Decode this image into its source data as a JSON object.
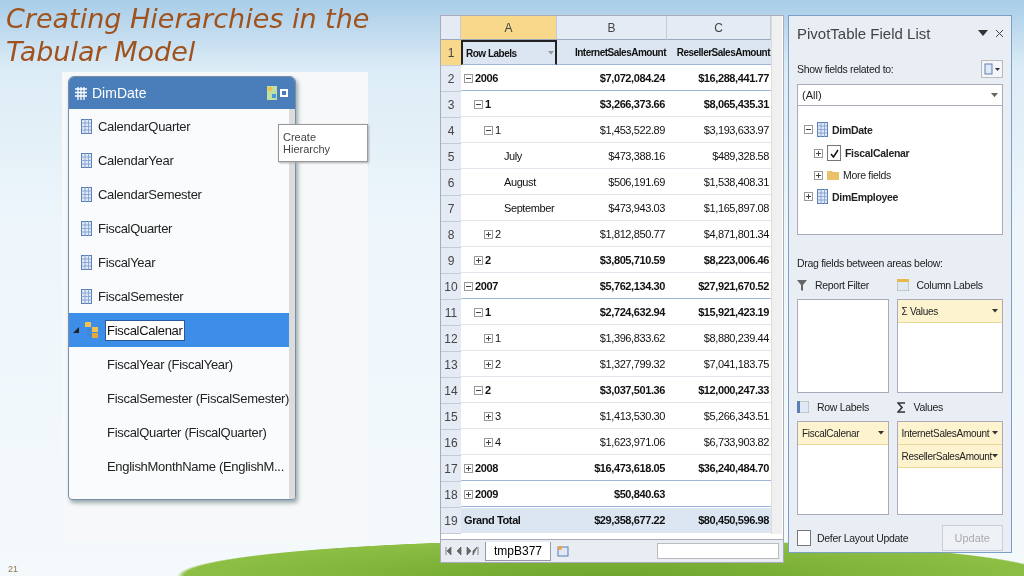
{
  "slide": {
    "title": "Creating Hierarchies in the Tabular Model",
    "page_number": "21"
  },
  "model_table": {
    "title": "DimDate",
    "columns": [
      "CalendarQuarter",
      "CalendarYear",
      "CalendarSemester",
      "FiscalQuarter",
      "FiscalYear",
      "FiscalSemester"
    ],
    "hierarchy": {
      "name": "FiscalCalenar",
      "selected": true,
      "expanded": true,
      "levels": [
        "FiscalYear (FiscalYear)",
        "FiscalSemester (FiscalSemester)",
        "FiscalQuarter (FiscalQuarter)",
        "EnglishMonthName (EnglishM..."
      ]
    },
    "tooltip": "Create Hierarchy"
  },
  "sheet": {
    "column_headers": [
      {
        "label": "A",
        "selected": true
      },
      {
        "label": "B",
        "selected": false
      },
      {
        "label": "C",
        "selected": false
      }
    ],
    "header_row": {
      "number": "1",
      "selected": true,
      "cells": [
        "Row Labels",
        "InternetSalesAmount",
        "ResellerSalesAmount"
      ]
    },
    "rows": [
      {
        "number": "2",
        "label": "2006",
        "expanded": true,
        "bold": true,
        "values": [
          "$7,072,084.24",
          "$16,288,441.77"
        ],
        "children": [
          {
            "number": "3",
            "label": "1",
            "expanded": true,
            "bold": true,
            "values": [
              "$3,266,373.66",
              "$8,065,435.31"
            ],
            "children": [
              {
                "number": "4",
                "label": "1",
                "expanded": true,
                "bold": false,
                "values": [
                  "$1,453,522.89",
                  "$3,193,633.97"
                ],
                "children": [
                  {
                    "number": "5",
                    "label": "July",
                    "bold": false,
                    "values": [
                      "$473,388.16",
                      "$489,328.58"
                    ]
                  },
                  {
                    "number": "6",
                    "label": "August",
                    "bold": false,
                    "values": [
                      "$506,191.69",
                      "$1,538,408.31"
                    ]
                  },
                  {
                    "number": "7",
                    "label": "September",
                    "bold": false,
                    "values": [
                      "$473,943.03",
                      "$1,165,897.08"
                    ]
                  }
                ]
              },
              {
                "number": "8",
                "label": "2",
                "expanded": false,
                "bold": false,
                "values": [
                  "$1,812,850.77",
                  "$4,871,801.34"
                ]
              }
            ]
          },
          {
            "number": "9",
            "label": "2",
            "expanded": false,
            "bold": true,
            "values": [
              "$3,805,710.59",
              "$8,223,006.46"
            ]
          }
        ]
      },
      {
        "number": "10",
        "label": "2007",
        "expanded": true,
        "bold": true,
        "values": [
          "$5,762,134.30",
          "$27,921,670.52"
        ],
        "children": [
          {
            "number": "11",
            "label": "1",
            "expanded": true,
            "bold": true,
            "values": [
              "$2,724,632.94",
              "$15,921,423.19"
            ],
            "children": [
              {
                "number": "12",
                "label": "1",
                "expanded": false,
                "bold": false,
                "values": [
                  "$1,396,833.62",
                  "$8,880,239.44"
                ]
              },
              {
                "number": "13",
                "label": "2",
                "expanded": false,
                "bold": false,
                "values": [
                  "$1,327,799.32",
                  "$7,041,183.75"
                ]
              }
            ]
          },
          {
            "number": "14",
            "label": "2",
            "expanded": true,
            "bold": true,
            "values": [
              "$3,037,501.36",
              "$12,000,247.33"
            ],
            "children": [
              {
                "number": "15",
                "label": "3",
                "expanded": false,
                "bold": false,
                "values": [
                  "$1,413,530.30",
                  "$5,266,343.51"
                ]
              },
              {
                "number": "16",
                "label": "4",
                "expanded": false,
                "bold": false,
                "values": [
                  "$1,623,971.06",
                  "$6,733,903.82"
                ]
              }
            ]
          }
        ]
      },
      {
        "number": "17",
        "label": "2008",
        "expanded": false,
        "bold": true,
        "values": [
          "$16,473,618.05",
          "$36,240,484.70"
        ]
      },
      {
        "number": "18",
        "label": "2009",
        "expanded": false,
        "bold": true,
        "values": [
          "$50,840.63"
        ]
      }
    ],
    "grand_total": {
      "number": "19",
      "label": "Grand Total",
      "values": [
        "$29,358,677.22",
        "$80,450,596.98"
      ]
    },
    "sheet_tab": "tmpB377"
  },
  "field_list": {
    "title": "PivotTable Field List",
    "related_label": "Show fields related to:",
    "related_value": "(All)",
    "tables": [
      {
        "name": "DimDate",
        "expanded": true,
        "children": [
          {
            "name": "FiscalCalenar",
            "kind": "hierarchy",
            "checked": true
          },
          {
            "name": "More fields",
            "kind": "folder"
          }
        ]
      },
      {
        "name": "DimEmployee",
        "expanded": false
      }
    ],
    "areas_label": "Drag fields between areas below:",
    "areas": [
      {
        "kind": "filter",
        "title": "Report Filter"
      },
      {
        "kind": "columns",
        "title": "Column Labels",
        "items": [
          "Σ Values"
        ]
      },
      {
        "kind": "rows",
        "title": "Row Labels",
        "items": [
          "FiscalCalenar"
        ]
      },
      {
        "kind": "values",
        "title": "Values",
        "items": [
          "InternetSalesAmount",
          "ResellerSalesAmount"
        ]
      }
    ],
    "defer_label": "Defer Layout Update",
    "defer_checked": false,
    "update_button": {
      "label": "Update",
      "disabled": true
    }
  }
}
